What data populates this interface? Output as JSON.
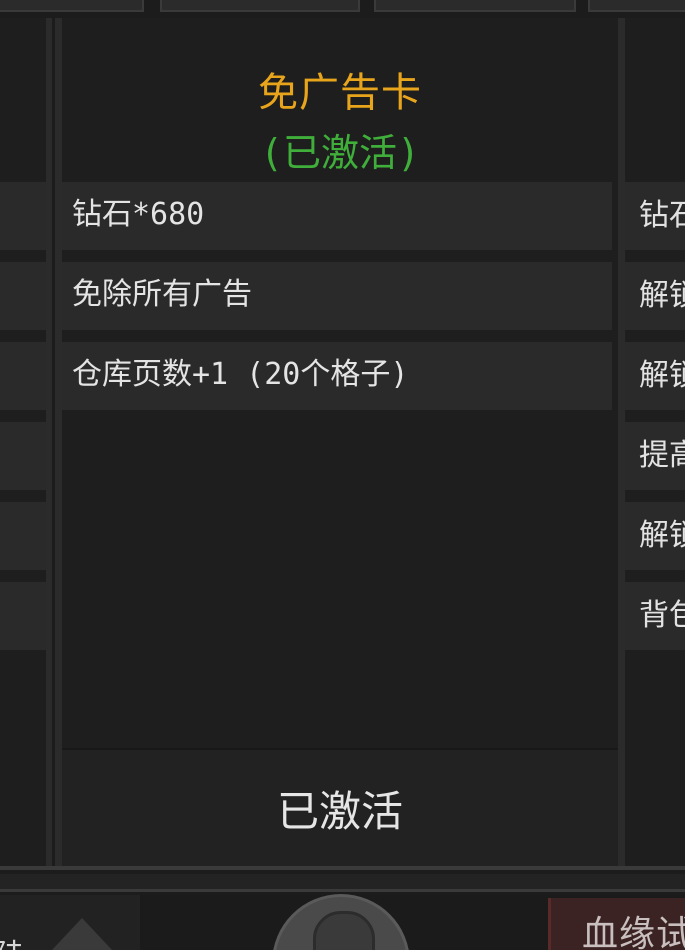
{
  "left_card": {
    "rows": [
      "",
      "",
      "",
      "",
      "",
      ""
    ]
  },
  "center_card": {
    "title": "免广告卡",
    "status": "(已激活)",
    "features": [
      "钻石*680",
      "免除所有广告",
      "仓库页数+1 (20个格子)"
    ],
    "action_label": "已激活"
  },
  "right_card": {
    "rows": [
      "钻石",
      "解锁",
      "解锁",
      "提高",
      "解锁",
      "背包"
    ]
  },
  "bottom": {
    "left_text": "陆",
    "right_text": "血缘试"
  },
  "colors": {
    "title": "#e8a51c",
    "status": "#3fae3a",
    "background": "#1c1c1c",
    "row": "#2a2a2a"
  }
}
